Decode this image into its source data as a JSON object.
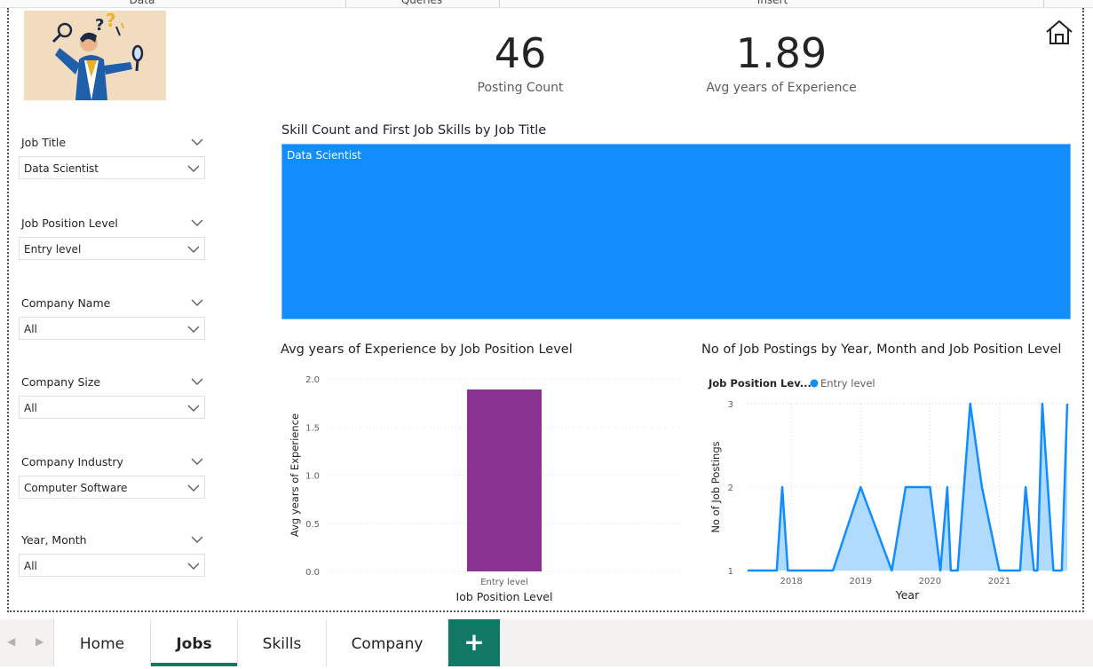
{
  "ribbon": {
    "items": [
      "Data",
      "Queries",
      "Insert"
    ]
  },
  "kpis": [
    {
      "value": "46",
      "label": "Posting Count"
    },
    {
      "value": "1.89",
      "label": "Avg years of Experience"
    }
  ],
  "slicers": [
    {
      "title": "Job Title",
      "value": "Data Scientist"
    },
    {
      "title": "Job Position Level",
      "value": "Entry level"
    },
    {
      "title": "Company Name",
      "value": "All"
    },
    {
      "title": "Company Size",
      "value": "All"
    },
    {
      "title": "Company Industry",
      "value": "Computer Software"
    },
    {
      "title": "Year, Month",
      "value": "All"
    }
  ],
  "treemap": {
    "title": "Skill Count and First Job Skills by Job Title",
    "tile_label": "Data Scientist"
  },
  "bar_chart_title": "Avg years of Experience by Job Position Level",
  "line_chart_title": "No of Job Postings by Year, Month and Job Position Level",
  "tabs": {
    "items": [
      "Home",
      "Jobs",
      "Skills",
      "Company"
    ],
    "active": "Jobs",
    "add_label": "+"
  },
  "colors": {
    "accent": "#117865",
    "treemap": "#118dff",
    "bar": "#8a3393",
    "area_line": "#118dff",
    "area_fill": "#a3d3ff"
  },
  "chart_data": [
    {
      "type": "bar",
      "title": "Avg years of Experience by Job Position Level",
      "xlabel": "Job Position Level",
      "ylabel": "Avg years of Experience",
      "categories": [
        "Entry level"
      ],
      "values": [
        1.89
      ],
      "ylim": [
        0,
        2.0
      ],
      "yticks": [
        "0.0",
        "0.5",
        "1.0",
        "1.5",
        "2.0"
      ],
      "grid": true
    },
    {
      "type": "area",
      "title": "No of Job Postings by Year, Month and Job Position Level",
      "xlabel": "Year",
      "ylabel": "No of Job Postings",
      "legend_title": "Job Position Lev...",
      "legend": [
        "Entry level"
      ],
      "xticks": [
        "2018",
        "2019",
        "2020",
        "2021"
      ],
      "yticks": [
        "1",
        "2",
        "3"
      ],
      "ylim": [
        1,
        3
      ],
      "xlim": [
        2017.37,
        2021.98
      ],
      "grid": true,
      "series": [
        {
          "name": "Entry level",
          "x": [
            2017.37,
            2017.79,
            2017.87,
            2017.95,
            2018.3,
            2018.6,
            2019.0,
            2019.45,
            2019.65,
            2019.95,
            2020.0,
            2020.15,
            2020.25,
            2020.3,
            2020.4,
            2020.58,
            2020.75,
            2021.0,
            2021.15,
            2021.3,
            2021.38,
            2021.5,
            2021.55,
            2021.62,
            2021.78,
            2021.85,
            2021.9,
            2021.98
          ],
          "values": [
            1,
            1,
            2,
            1,
            1,
            1,
            2,
            1,
            2,
            2,
            2,
            1,
            2,
            1,
            1,
            3,
            2,
            1,
            1,
            1,
            2,
            1,
            1,
            3,
            1,
            1,
            1,
            3
          ]
        }
      ]
    }
  ]
}
